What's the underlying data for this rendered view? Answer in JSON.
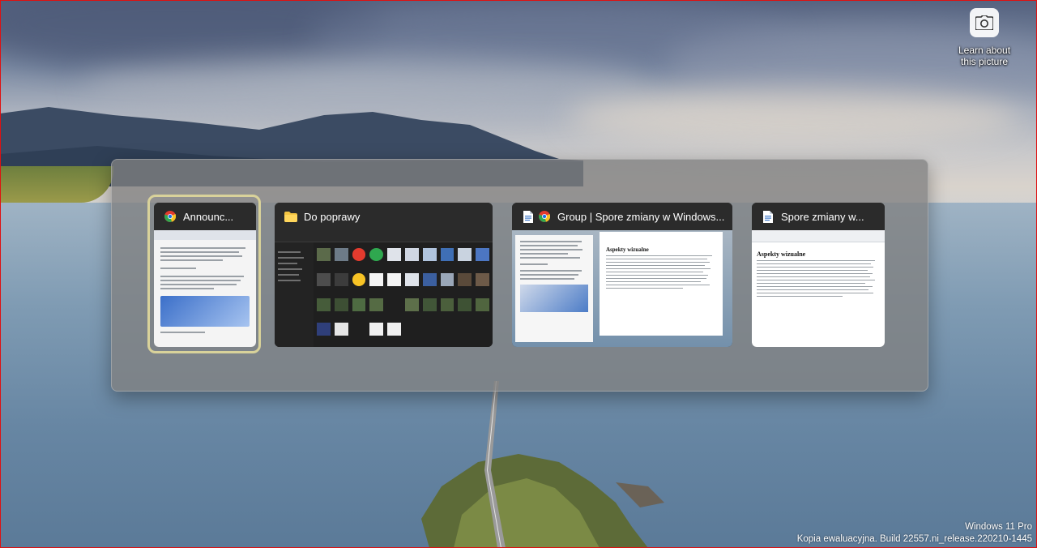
{
  "desktop": {
    "spotlight_label": "Learn about this picture",
    "spotlight_icon": "camera-icon"
  },
  "watermark": {
    "line1": "Windows 11 Pro",
    "line2": "Kopia ewaluacyjna. Build 22557.ni_release.220210-1445"
  },
  "switcher": {
    "windows": [
      {
        "title": "Announc...",
        "app_icon": "chrome-icon",
        "selected": true
      },
      {
        "title": "Do poprawy",
        "app_icon": "folder-icon",
        "selected": false
      },
      {
        "title": "Group | Spore zmiany w Windows...",
        "app_icon": "document-icon",
        "secondary_icon": "chrome-icon",
        "selected": false
      },
      {
        "title": "Spore zmiany w...",
        "app_icon": "document-icon",
        "selected": false
      }
    ],
    "preview_heading": "Aspekty wizualne",
    "selection_color": "#d9d29a"
  }
}
